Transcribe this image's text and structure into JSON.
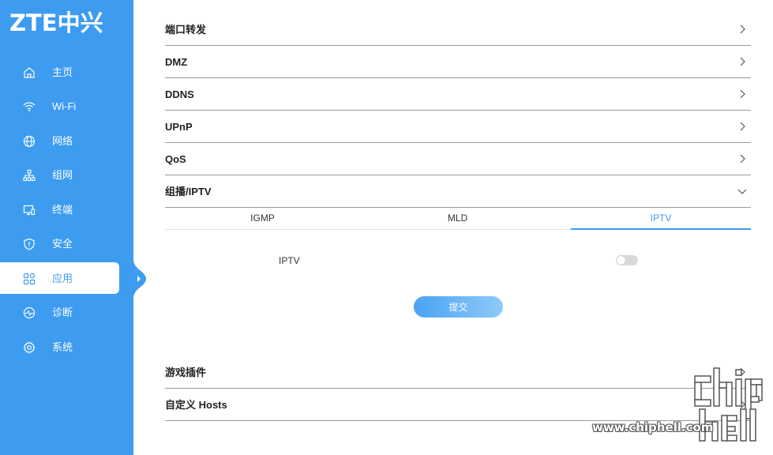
{
  "logo": {
    "text": "ZTE中兴"
  },
  "sidebar": {
    "items": [
      {
        "label": "主页",
        "icon": "home-icon"
      },
      {
        "label": "Wi-Fi",
        "icon": "wifi-icon"
      },
      {
        "label": "网络",
        "icon": "globe-icon"
      },
      {
        "label": "组网",
        "icon": "mesh-network-icon"
      },
      {
        "label": "终端",
        "icon": "device-monitor-icon"
      },
      {
        "label": "安全",
        "icon": "shield-icon"
      },
      {
        "label": "应用",
        "icon": "apps-grid-icon",
        "active": true
      },
      {
        "label": "诊断",
        "icon": "diagnostics-icon"
      },
      {
        "label": "系统",
        "icon": "gear-icon"
      }
    ]
  },
  "main": {
    "sections": [
      {
        "label": "端口转发",
        "expanded": false
      },
      {
        "label": "DMZ",
        "expanded": false
      },
      {
        "label": "DDNS",
        "expanded": false
      },
      {
        "label": "UPnP",
        "expanded": false
      },
      {
        "label": "QoS",
        "expanded": false
      },
      {
        "label": "组播/IPTV",
        "expanded": true
      }
    ],
    "tabs": [
      {
        "label": "IGMP",
        "active": false
      },
      {
        "label": "MLD",
        "active": false
      },
      {
        "label": "IPTV",
        "active": true
      }
    ],
    "iptv": {
      "label": "IPTV",
      "enabled": false,
      "submit_label": "提交"
    },
    "lower_sections": [
      {
        "label": "游戏插件"
      },
      {
        "label": "自定义 Hosts"
      }
    ]
  },
  "watermark": {
    "url": "www.chiphell.com",
    "logo_text": "chip hell"
  },
  "colors": {
    "accent": "#3d9cf0",
    "sidebar_bg": "#3d9cf0",
    "divider": "#9a9a9a",
    "toggle_off": "#d9d9d9"
  }
}
